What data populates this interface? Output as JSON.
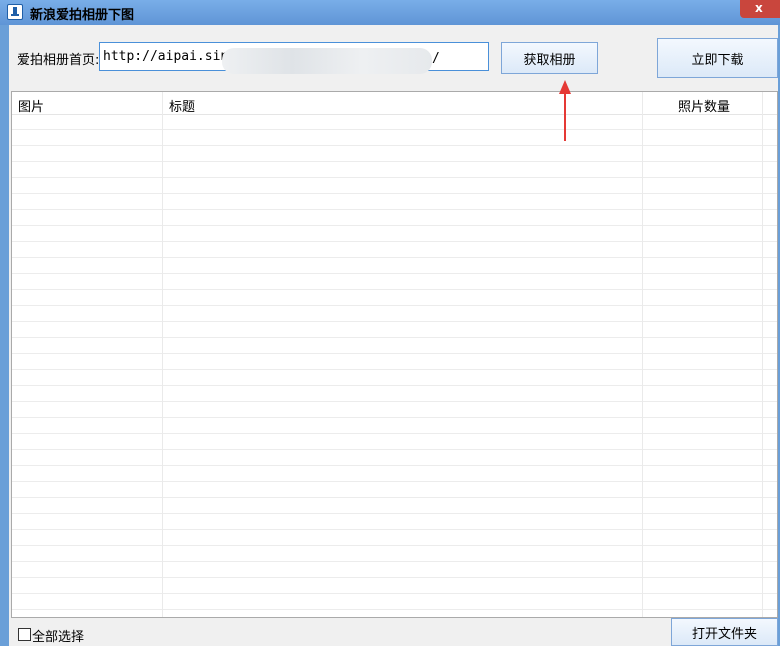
{
  "window": {
    "title": "新浪爱拍相册下图",
    "close_label": "x"
  },
  "form": {
    "url_label": "爱拍相册首页:",
    "url_value": "http://aipai.sina.",
    "url_tail": "/",
    "get_album_button": "获取相册",
    "download_button": "立即下载"
  },
  "table": {
    "columns": [
      "图片",
      "标题",
      "照片数量"
    ],
    "rows": []
  },
  "footer": {
    "select_all_label": "全部选择",
    "open_folder_button": "打开文件夹"
  },
  "colors": {
    "title_bar": "#6a9fd8",
    "close_button": "#c9463d",
    "annotation_arrow": "#e53935"
  }
}
